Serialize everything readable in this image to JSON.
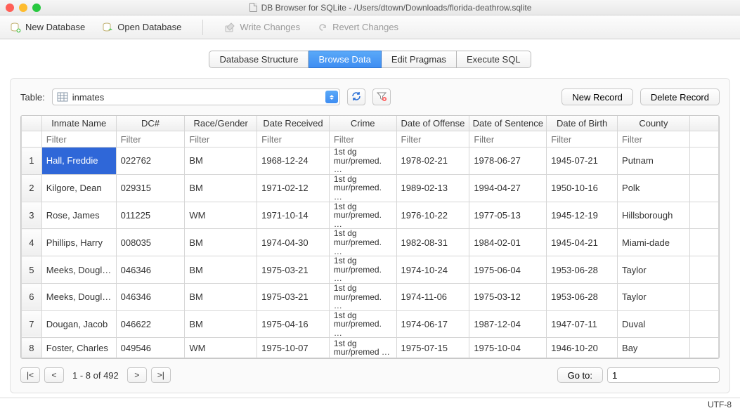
{
  "window": {
    "title": "DB Browser for SQLite - /Users/dtown/Downloads/florida-deathrow.sqlite"
  },
  "toolbar": {
    "new_db": "New Database",
    "open_db": "Open Database",
    "write_changes": "Write Changes",
    "revert_changes": "Revert Changes"
  },
  "tabs": {
    "structure": "Database Structure",
    "browse": "Browse Data",
    "pragmas": "Edit Pragmas",
    "sql": "Execute SQL"
  },
  "browse": {
    "table_label": "Table:",
    "table_value": "inmates",
    "new_record": "New Record",
    "delete_record": "Delete Record",
    "columns": [
      "Inmate Name",
      "DC#",
      "Race/Gender",
      "Date Received",
      "Crime",
      "Date of Offense",
      "Date of Sentence",
      "Date of Birth",
      "County"
    ],
    "filter_placeholder": "Filter",
    "rows": [
      {
        "n": "1",
        "name": "Hall, Freddie",
        "dc": "022762",
        "rg": "BM",
        "recv": "1968-12-24",
        "crime": "1st dg mur/premed. …",
        "off": "1978-02-21",
        "sent": "1978-06-27",
        "dob": "1945-07-21",
        "county": "Putnam",
        "sel": true
      },
      {
        "n": "2",
        "name": "Kilgore, Dean",
        "dc": "029315",
        "rg": "BM",
        "recv": "1971-02-12",
        "crime": "1st dg mur/premed. …",
        "off": "1989-02-13",
        "sent": "1994-04-27",
        "dob": "1950-10-16",
        "county": "Polk"
      },
      {
        "n": "3",
        "name": "Rose, James",
        "dc": "011225",
        "rg": "WM",
        "recv": "1971-10-14",
        "crime": "1st dg mur/premed. …",
        "off": "1976-10-22",
        "sent": "1977-05-13",
        "dob": "1945-12-19",
        "county": "Hillsborough"
      },
      {
        "n": "4",
        "name": "Phillips, Harry",
        "dc": "008035",
        "rg": "BM",
        "recv": "1974-04-30",
        "crime": "1st dg mur/premed. …",
        "off": "1982-08-31",
        "sent": "1984-02-01",
        "dob": "1945-04-21",
        "county": "Miami-dade"
      },
      {
        "n": "5",
        "name": "Meeks, Douglas",
        "dc": "046346",
        "rg": "BM",
        "recv": "1975-03-21",
        "crime": "1st dg mur/premed. …",
        "off": "1974-10-24",
        "sent": "1975-06-04",
        "dob": "1953-06-28",
        "county": "Taylor"
      },
      {
        "n": "6",
        "name": "Meeks, Douglas",
        "dc": "046346",
        "rg": "BM",
        "recv": "1975-03-21",
        "crime": "1st dg mur/premed. …",
        "off": "1974-11-06",
        "sent": "1975-03-12",
        "dob": "1953-06-28",
        "county": "Taylor"
      },
      {
        "n": "7",
        "name": "Dougan, Jacob",
        "dc": "046622",
        "rg": "BM",
        "recv": "1975-04-16",
        "crime": "1st dg mur/premed. …",
        "off": "1974-06-17",
        "sent": "1987-12-04",
        "dob": "1947-07-11",
        "county": "Duval"
      },
      {
        "n": "8",
        "name": "Foster, Charles",
        "dc": "049546",
        "rg": "WM",
        "recv": "1975-10-07",
        "crime": "1st dg mur/premed …",
        "off": "1975-07-15",
        "sent": "1975-10-04",
        "dob": "1946-10-20",
        "county": "Bay"
      }
    ],
    "pager": {
      "first": "|<",
      "prev": "<",
      "next": ">",
      "last": ">|",
      "range": "1 - 8 of 492",
      "goto_label": "Go to:",
      "goto_value": "1"
    }
  },
  "status": {
    "encoding": "UTF-8"
  }
}
